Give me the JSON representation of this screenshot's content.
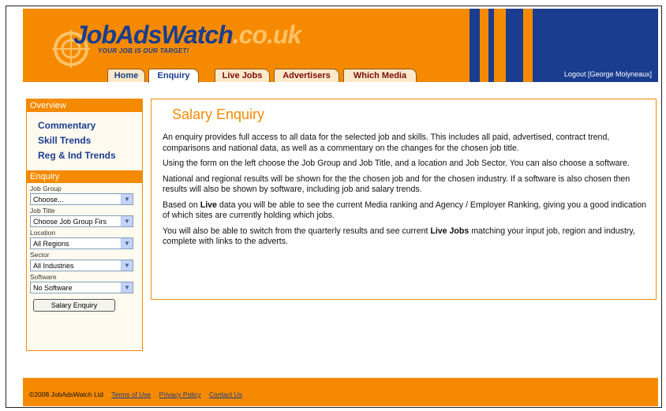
{
  "brand": {
    "logo_name": "JobAdsWatch",
    "logo_domain": ".co.uk",
    "tagline": "YOUR JOB IS OUR TARGET!",
    "primary_color": "#f58a00",
    "accent_color": "#1a3d8f"
  },
  "header": {
    "logout_text": "Logout [George Molyneaux]"
  },
  "tabs": [
    {
      "label": "Home",
      "active": false
    },
    {
      "label": "Enquiry",
      "active": true
    },
    {
      "label": "Live Jobs",
      "active": false
    },
    {
      "label": "Advertisers",
      "active": false
    },
    {
      "label": "Which Media",
      "active": false
    }
  ],
  "sidebar": {
    "overview_heading": "Overview",
    "overview_links": [
      "Commentary",
      "Skill Trends",
      "Reg & Ind Trends"
    ],
    "enquiry_heading": "Enquiry",
    "fields": [
      {
        "label": "Job Group",
        "value": "Choose..."
      },
      {
        "label": "Job Title",
        "value": "Choose Job Group Firs"
      },
      {
        "label": "Location",
        "value": "All Regions"
      },
      {
        "label": "Sector",
        "value": "All Industries"
      },
      {
        "label": "Software",
        "value": "No Software"
      }
    ],
    "submit_label": "Salary Enquiry"
  },
  "main": {
    "title": "Salary Enquiry",
    "p1": "An enquiry provides full access to all data for the selected job and skills. This includes all paid, advertised, contract trend, comparisons and national data, as well as a commentary on the changes for the chosen job title.",
    "p2": "Using the form on the left choose the Job Group and Job Title, and a location and Job Sector. You can also choose a software.",
    "p3": "National and regional results will be shown for the the chosen job and for the chosen industry. If a software is also chosen then results will also be shown by software, including job and salary trends.",
    "p4_a": "Based on ",
    "p4_bold": "Live",
    "p4_b": " data you will be able to see the current Media ranking and Agency / Employer Ranking, giving you a good indication of which sites are currently holding which jobs.",
    "p5_a": "You will also be able to switch from the quarterly results and see current ",
    "p5_bold": "Live Jobs",
    "p5_b": " matching your input job, region and industry, complete with links to the adverts."
  },
  "footer": {
    "copyright": "©2008 JobAdsWatch Ltd",
    "links": [
      "Terms of Use",
      "Privacy Policy",
      "Contact Us"
    ]
  }
}
